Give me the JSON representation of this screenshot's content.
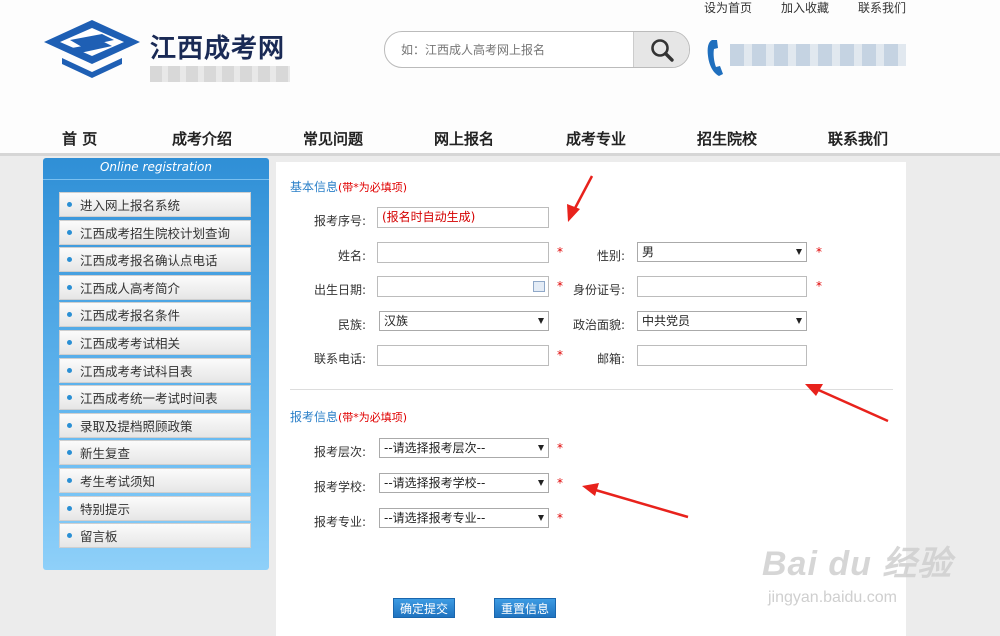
{
  "header": {
    "top_links": [
      "设为首页",
      "加入收藏",
      "联系我们"
    ],
    "site_title": "江西成考网",
    "search_placeholder": "如：江西成人高考网上报名"
  },
  "nav": [
    "首 页",
    "成考介绍",
    "常见问题",
    "网上报名",
    "成考专业",
    "招生院校",
    "联系我们"
  ],
  "sidebar": {
    "title": "Online registration",
    "items": [
      "进入网上报名系统",
      "江西成考招生院校计划查询",
      "江西成考报名确认点电话",
      "江西成人高考简介",
      "江西成考报名条件",
      "江西成考考试相关",
      "江西成考考试科目表",
      "江西成考统一考试时间表",
      "录取及提档照顾政策",
      "新生复查",
      "考生考试须知",
      "特别提示",
      "留言板"
    ]
  },
  "form": {
    "basic_title": "基本信息",
    "required_note": "(带*为必填项)",
    "exam_title": "报考信息",
    "star": "*",
    "labels": {
      "serial": "报考序号:",
      "name": "姓名:",
      "gender": "性别:",
      "birth": "出生日期:",
      "id_no": "身份证号:",
      "ethnicity": "民族:",
      "political": "政治面貌:",
      "phone": "联系电话:",
      "email": "邮箱:",
      "level": "报考层次:",
      "school": "报考学校:",
      "major": "报考专业:"
    },
    "values": {
      "serial": "(报名时自动生成)",
      "name": "",
      "gender": "男",
      "birth": "",
      "id_no": "",
      "ethnicity": "汉族",
      "political": "中共党员",
      "phone": "",
      "email": "",
      "level": "--请选择报考层次--",
      "school": "--请选择报考学校--",
      "major": "--请选择报考专业--"
    },
    "submit_label": "确定提交",
    "reset_label": "重置信息"
  },
  "watermark": {
    "big": "Bai du 经验",
    "small": "jingyan.baidu.com"
  },
  "colors": {
    "accent_blue": "#2a7fc8",
    "required_red": "#e00000",
    "annotation_red": "#e8221c"
  }
}
